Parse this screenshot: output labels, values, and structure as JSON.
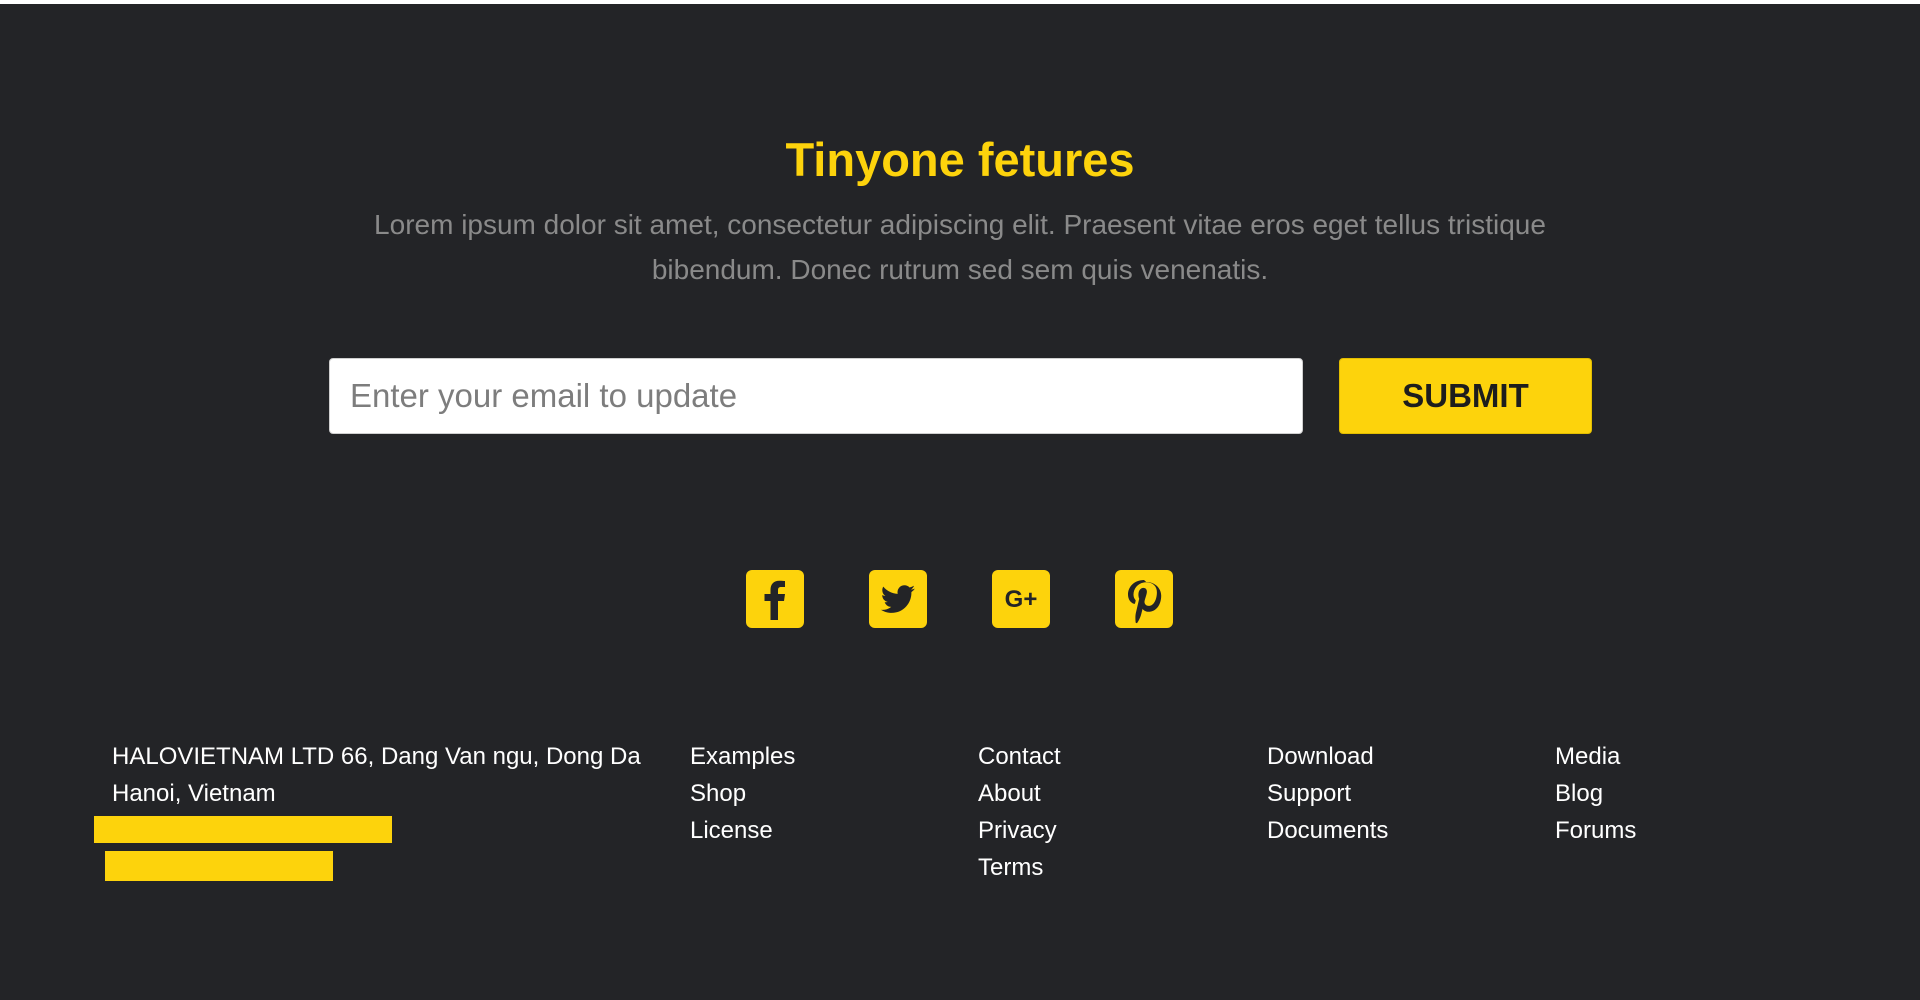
{
  "newsletter": {
    "title": "Tinyone fetures",
    "description": "Lorem ipsum dolor sit amet, consectetur adipiscing elit. Praesent vitae eros eget tellus tristique bibendum. Donec rutrum sed sem quis venenatis.",
    "email_placeholder": "Enter your email to update",
    "email_value": "",
    "submit_label": "SUBMIT"
  },
  "social": [
    {
      "icon": "facebook-icon"
    },
    {
      "icon": "twitter-icon"
    },
    {
      "icon": "google-plus-icon",
      "glyph": "G+"
    },
    {
      "icon": "pinterest-icon"
    }
  ],
  "footer": {
    "address_line1": "HALOVIETNAM LTD 66, Dang Van ngu, Dong Da",
    "address_line2": "Hanoi, Vietnam",
    "columns": [
      {
        "links": [
          "Examples",
          "Shop",
          "License"
        ]
      },
      {
        "links": [
          "Contact",
          "About",
          "Privacy",
          "Terms"
        ]
      },
      {
        "links": [
          "Download",
          "Support",
          "Documents"
        ]
      },
      {
        "links": [
          "Media",
          "Blog",
          "Forums"
        ]
      }
    ]
  },
  "colors": {
    "background": "#232427",
    "accent": "#fdd30c",
    "muted_text": "#8a8a8a",
    "text": "#ffffff"
  }
}
